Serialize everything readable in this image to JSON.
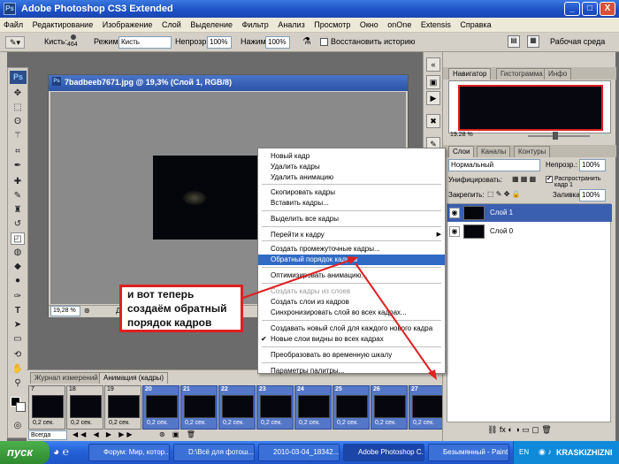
{
  "titlebar": {
    "title": "Adobe Photoshop CS3 Extended",
    "logo": "Ps",
    "minimize": "_",
    "restore": "□",
    "close": "X"
  },
  "menubar": {
    "items": [
      "Файл",
      "Редактирование",
      "Изображение",
      "Слой",
      "Выделение",
      "Фильтр",
      "Анализ",
      "Просмотр",
      "Окно",
      "onOne",
      "Extensis",
      "Справка"
    ]
  },
  "options": {
    "brush_label": "Кисть:",
    "brush_size": "464",
    "mode_label": "Режим:",
    "mode_value": "Кисть",
    "opacity_label": "Непрозр.:",
    "opacity_value": "100%",
    "flow_label": "Нажим:",
    "flow_value": "100%",
    "history_label": "Восстановить историю",
    "workspace_label": "Рабочая среда"
  },
  "document": {
    "title": "7badbeeb7671.jpg @ 19,3% (Слой 1, RGB/8)",
    "zoom": "19,28 %",
    "status_text": "Д"
  },
  "panels": {
    "nav_tabs": [
      "Навигатор",
      "Гистограмма",
      "Инфо"
    ],
    "nav_zoom": "19.28 %",
    "layer_tabs": [
      "Слои",
      "Каналы",
      "Контуры"
    ],
    "blend_mode": "Нормальный",
    "opacity_label": "Непрозр.:",
    "opacity_value": "100%",
    "unify_label": "Унифицировать:",
    "propagate_label": "Распространить кадр 1",
    "lock_label": "Закрепить:",
    "fill_label": "Заливка:",
    "fill_value": "100%",
    "layers": [
      {
        "name": "Слой 1",
        "selected": true
      },
      {
        "name": "Слой 0",
        "selected": false
      }
    ]
  },
  "context_menu": {
    "items": [
      {
        "label": "Новый кадр",
        "state": "normal"
      },
      {
        "label": "Удалить кадры",
        "state": "normal"
      },
      {
        "label": "Удалить анимацию",
        "state": "normal"
      },
      {
        "label": "Скопировать кадры",
        "state": "normal"
      },
      {
        "label": "Вставить кадры...",
        "state": "normal"
      },
      {
        "label": "Выделить все кадры",
        "state": "normal"
      },
      {
        "label": "Перейти к кадру",
        "state": "normal",
        "submenu": true
      },
      {
        "label": "Создать промежуточные кадры...",
        "state": "normal"
      },
      {
        "label": "Обратный порядок кадров",
        "state": "selected"
      },
      {
        "label": "Оптимизировать анимацию...",
        "state": "normal"
      },
      {
        "label": "Создать кадры из слоев",
        "state": "disabled"
      },
      {
        "label": "Создать слои из кадров",
        "state": "normal"
      },
      {
        "label": "Синхронизировать слой во всех кадрах...",
        "state": "normal"
      },
      {
        "label": "Создавать новый слой для каждого нового кадра",
        "state": "normal"
      },
      {
        "label": "Новые слои видны во всех кадрах",
        "state": "normal",
        "checked": true
      },
      {
        "label": "Преобразовать во временную шкалу",
        "state": "normal"
      },
      {
        "label": "Параметры палитры...",
        "state": "normal"
      }
    ],
    "submenu_arrow": "▶",
    "check_mark": "✔"
  },
  "callout": {
    "lines": [
      "и вот теперь",
      "создаём обратный",
      "порядок кадров"
    ]
  },
  "animation": {
    "tabs": [
      "Журнал измерений",
      "Анимация (кадры)"
    ],
    "frames": [
      {
        "num": "7",
        "dur": "0,2 сек.",
        "sel": false
      },
      {
        "num": "18",
        "dur": "0,2 сек.",
        "sel": false
      },
      {
        "num": "19",
        "dur": "0,2 сек.",
        "sel": false
      },
      {
        "num": "20",
        "dur": "0,2 сек.",
        "sel": true
      },
      {
        "num": "21",
        "dur": "0,2 сек.",
        "sel": true
      },
      {
        "num": "22",
        "dur": "0,2 сек.",
        "sel": true
      },
      {
        "num": "23",
        "dur": "0,2 сек.",
        "sel": true
      },
      {
        "num": "24",
        "dur": "0,2 сек.",
        "sel": true
      },
      {
        "num": "25",
        "dur": "0,2 сек.",
        "sel": true
      },
      {
        "num": "26",
        "dur": "0,2 сек.",
        "sel": true
      },
      {
        "num": "27",
        "dur": "0,2 сек.",
        "sel": true
      }
    ],
    "loop": "Всегда"
  },
  "taskbar": {
    "start": "пуск",
    "tasks": [
      {
        "label": "Форум: Мир, котор...",
        "active": false
      },
      {
        "label": "D:\\Всё для фотош...",
        "active": false
      },
      {
        "label": "2010-03-04_18342...",
        "active": false
      },
      {
        "label": "Adobe Photoshop C...",
        "active": true
      },
      {
        "label": "Безымянный - Paint",
        "active": false
      }
    ],
    "lang": "EN",
    "watermark": "KRASKIZHIZNI"
  },
  "colors": {
    "accent": "#316ac5",
    "callout_border": "#e02020",
    "arrow": "#e02020",
    "frame_selected": "#5577c8"
  }
}
